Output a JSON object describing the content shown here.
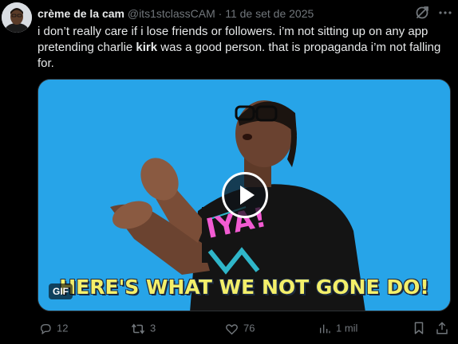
{
  "tweet": {
    "author_name": "crème de la cam",
    "handle": "@its1stclassCAM",
    "separator": "·",
    "date": "11 de set de 2025",
    "text_part1": "i don’t really care if i lose friends or followers. i’m not sitting up on any app pretending charlie ",
    "text_bold": "kirk",
    "text_part2": " was a good person. that is propaganda i’m not falling for."
  },
  "media": {
    "caption": "HERE'S WHAT WE NOT GONE DO!",
    "shirt_text": "IYA!",
    "badge": "GIF",
    "background_color": "#27a4e8",
    "icon": "play-icon"
  },
  "actions": {
    "replies": "12",
    "reposts": "3",
    "likes": "76",
    "views": "1 mil"
  },
  "icons": {
    "grok": "grok-icon",
    "more": "more-icon",
    "reply": "reply-icon",
    "repost": "repost-icon",
    "like": "heart-icon",
    "views": "views-icon",
    "bookmark": "bookmark-icon",
    "share": "share-icon"
  },
  "colors": {
    "background": "#000000",
    "primary_text": "#e7e9ea",
    "secondary_text": "#71767b",
    "caption_text": "#f3ef6a"
  }
}
